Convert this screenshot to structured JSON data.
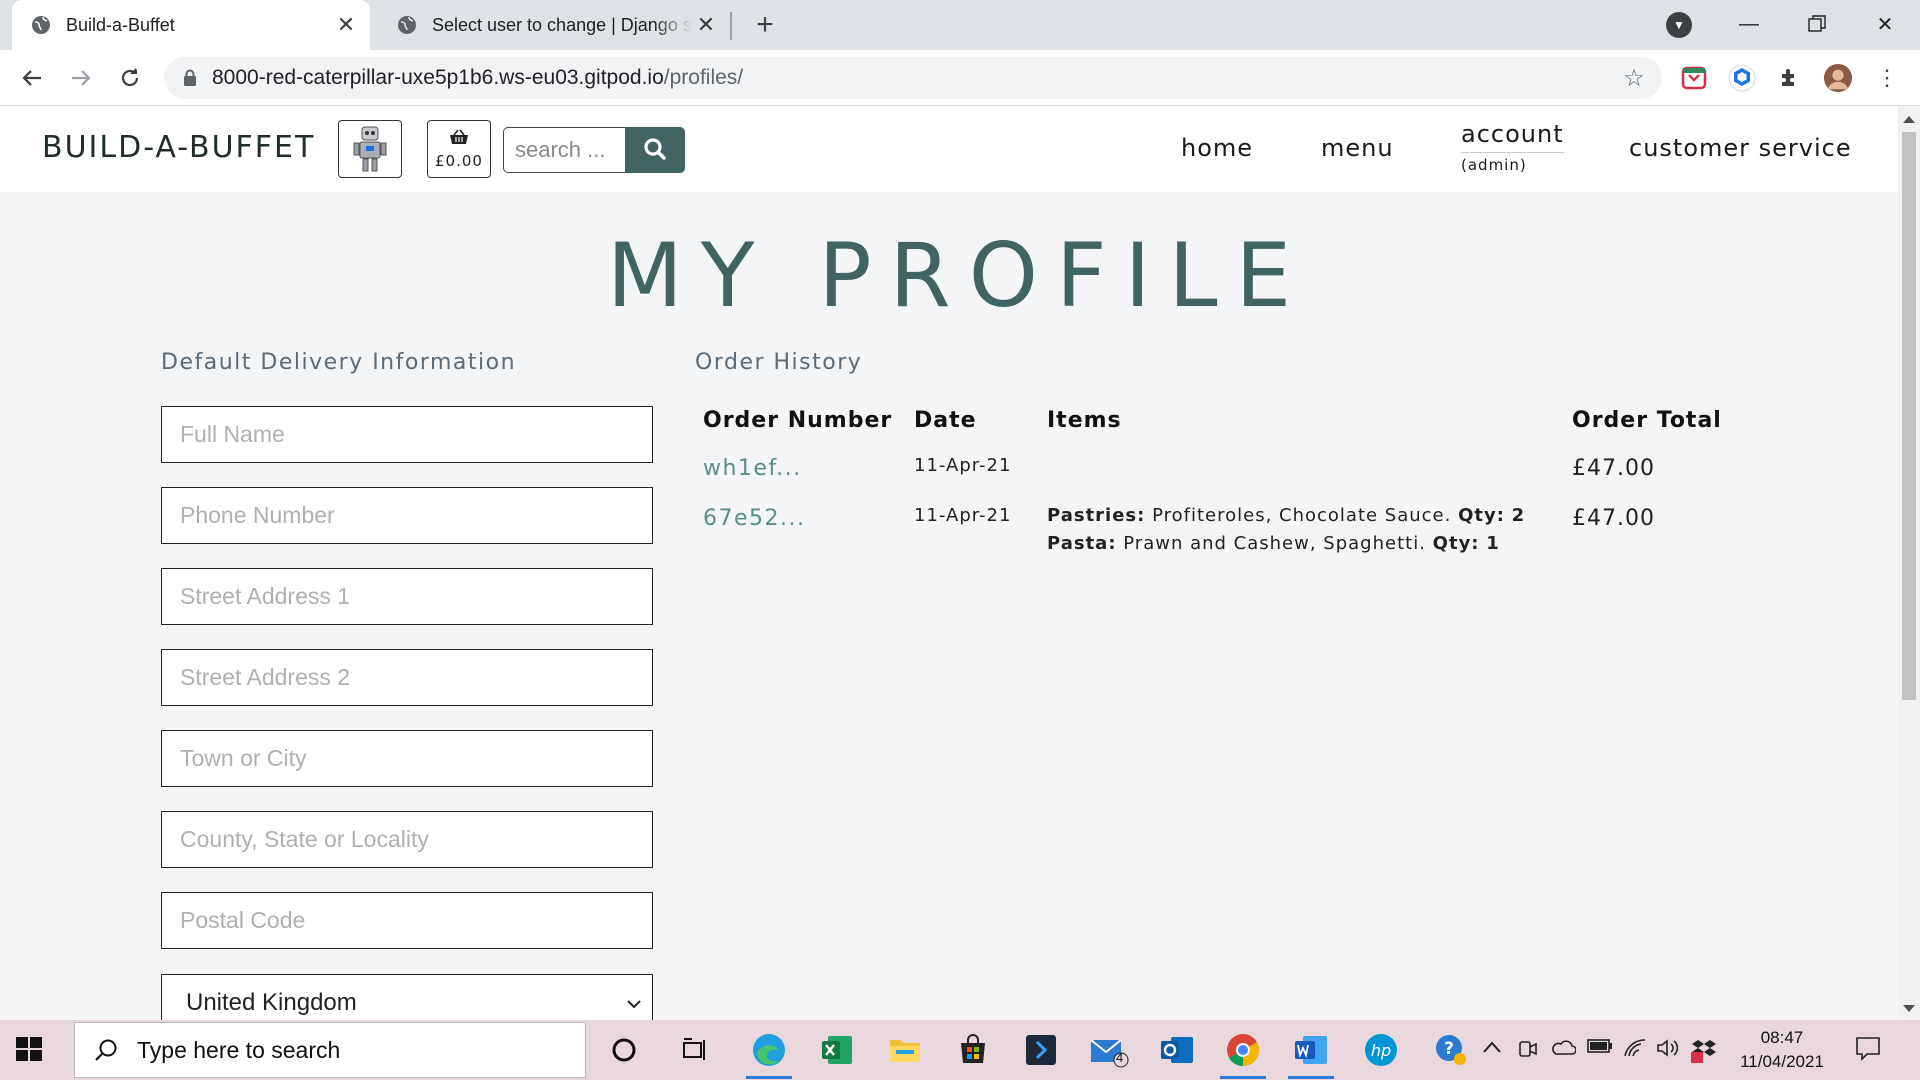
{
  "browser": {
    "tabs": [
      {
        "title": "Build-a-Buffet",
        "active": true
      },
      {
        "title": "Select user to change | Django site admin",
        "active": false
      }
    ],
    "url_host": "8000-red-caterpillar-uxe5p1b6.ws-eu03.gitpod.io",
    "url_path": "/profiles/"
  },
  "site": {
    "logo": "BUILD-A-BUFFET",
    "basket_total": "£0.00",
    "search_placeholder": "search ...",
    "nav": {
      "home": "home",
      "menu": "menu",
      "account": "account",
      "account_sub": "(admin)",
      "customer_service": "customer service"
    }
  },
  "profile": {
    "title": "MY PROFILE",
    "delivery_heading": "Default Delivery Information",
    "fields": [
      {
        "placeholder": "Full Name",
        "value": ""
      },
      {
        "placeholder": "Phone Number",
        "value": ""
      },
      {
        "placeholder": "Street Address 1",
        "value": ""
      },
      {
        "placeholder": "Street Address 2",
        "value": ""
      },
      {
        "placeholder": "Town or City",
        "value": ""
      },
      {
        "placeholder": "County, State or Locality",
        "value": ""
      },
      {
        "placeholder": "Postal Code",
        "value": ""
      }
    ],
    "country": "United Kingdom",
    "history_heading": "Order History",
    "columns": [
      "Order Number",
      "Date",
      "Items",
      "Order Total"
    ],
    "orders": [
      {
        "number": "wh1ef...",
        "date": "11-Apr-21",
        "items": [],
        "total": "£47.00"
      },
      {
        "number": "67e52...",
        "date": "11-Apr-21",
        "items": [
          {
            "category": "Pastries:",
            "desc": "Profiteroles, Chocolate Sauce.",
            "qty_label": "Qty:",
            "qty": "2"
          },
          {
            "category": "Pasta:",
            "desc": "Prawn and Cashew, Spaghetti.",
            "qty_label": "Qty:",
            "qty": "1"
          }
        ],
        "total": "£47.00"
      }
    ]
  },
  "taskbar": {
    "search_placeholder": "Type here to search",
    "mail_badge": "4",
    "time": "08:47",
    "date": "11/04/2021"
  },
  "colors": {
    "accent": "#3f6461",
    "link": "#5a8d88",
    "page_bg": "#f3f5f7"
  }
}
